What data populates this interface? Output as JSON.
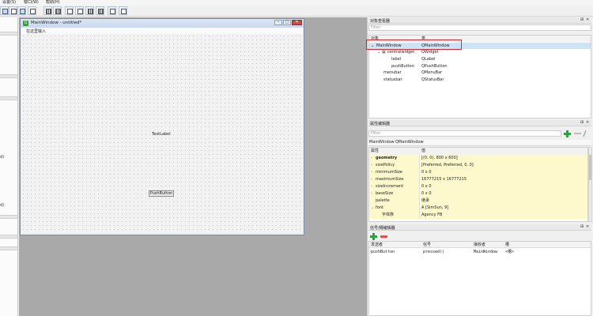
{
  "menubar": {
    "items": [
      "设置(S)",
      "窗口(W)",
      "帮助(H)"
    ]
  },
  "toolbar": {
    "buttons": [
      "widget-editor",
      "signal-slot-editor",
      "buddy-editor",
      "tab-order-editor",
      "layout-horizontal",
      "layout-vertical",
      "layout-splitter-h",
      "layout-splitter-v",
      "layout-grid",
      "layout-form",
      "break-layout",
      "adjust-size"
    ]
  },
  "left_dock": {
    "chars": [
      "d)",
      "d)"
    ]
  },
  "form_window": {
    "title": "MainWindow - untitled*",
    "menu_placeholder": "在这里输入",
    "label_text": "TextLabel",
    "button_text": "PushButton",
    "buttons": {
      "minimize": "–",
      "maximize": "□",
      "close": "✕"
    }
  },
  "object_inspector": {
    "title": "对象查看器",
    "filter_placeholder": "Filter",
    "col_object": "对象",
    "col_class": "类",
    "rows": [
      {
        "object": "MainWindow",
        "class": "QMainWindow"
      },
      {
        "object": "centralwidget",
        "class": "QWidget"
      },
      {
        "object": "label",
        "class": "QLabel"
      },
      {
        "object": "pushButton",
        "class": "QPushButton"
      },
      {
        "object": "menubar",
        "class": "QMenuBar"
      },
      {
        "object": "statusbar",
        "class": "QStatusBar"
      }
    ]
  },
  "property_editor": {
    "title": "属性编辑器",
    "filter_placeholder": "Filter",
    "object_name": "MainWindow",
    "class_name": "QMainWindow",
    "col_property": "属性",
    "col_value": "值",
    "rows": [
      {
        "name": "geometry",
        "value": "[(0, 0), 800 x 600]"
      },
      {
        "name": "sizePolicy",
        "value": "[Preferred, Preferred, 0, 0]"
      },
      {
        "name": "minimumSize",
        "value": "0 x 0"
      },
      {
        "name": "maximumSize",
        "value": "16777215 x 16777215"
      },
      {
        "name": "sizeIncrement",
        "value": "0 x 0"
      },
      {
        "name": "baseSize",
        "value": "0 x 0"
      },
      {
        "name": "palette",
        "value": "继承"
      },
      {
        "name": "font",
        "value": "A  [SimSun, 9]"
      },
      {
        "name": "字体族",
        "value": "Agency FB"
      }
    ]
  },
  "signal_slot_editor": {
    "title": "信号/槽编辑器",
    "cols": [
      "发送者",
      "信号",
      "接收者",
      "槽"
    ],
    "rows": [
      {
        "sender": "pushButton",
        "signal": "pressed()",
        "receiver": "MainWindow",
        "slot": "<槽>"
      }
    ]
  },
  "panel_buttons": {
    "float": "⊞",
    "close": "✕"
  },
  "colors": {
    "selection": "#cfe3f7",
    "highlight_border": "#d0282c",
    "property_yellow": "#fdf9cd",
    "add_green": "#2ea043",
    "remove_red": "#d9534f"
  }
}
